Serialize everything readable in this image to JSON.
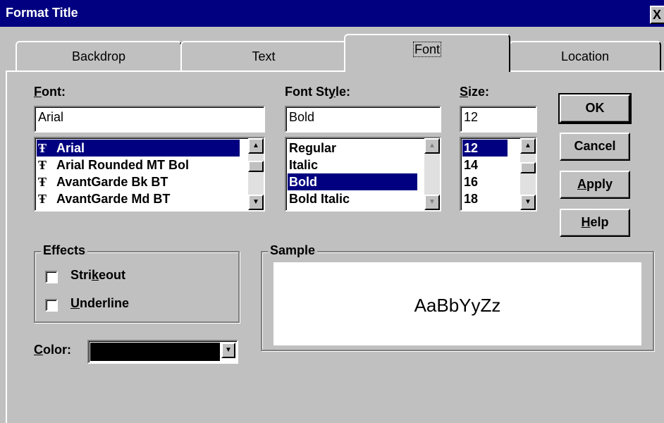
{
  "window": {
    "title": "Format Title",
    "close_glyph": "X"
  },
  "tabs": [
    {
      "label": "Backdrop",
      "active": false
    },
    {
      "label": "Text",
      "active": false
    },
    {
      "label": "Font",
      "active": true
    },
    {
      "label": "Location",
      "active": false
    }
  ],
  "font": {
    "label_prefix": "F",
    "label_rest": "ont:",
    "value": "Arial",
    "items": [
      "Arial",
      "Arial Rounded MT Bol",
      "AvantGarde Bk BT",
      "AvantGarde Md BT"
    ],
    "selected_index": 0,
    "item_icon": "truetype-icon"
  },
  "font_style": {
    "label_prefix": "Font St",
    "label_u": "y",
    "label_rest": "le:",
    "value": "Bold",
    "items": [
      "Regular",
      "Italic",
      "Bold",
      "Bold Italic"
    ],
    "selected_index": 2
  },
  "size": {
    "label_prefix": "S",
    "label_rest": "ize:",
    "value": "12",
    "items": [
      "12",
      "14",
      "16",
      "18"
    ],
    "selected_index": 0
  },
  "buttons": {
    "ok": "OK",
    "cancel": "Cancel",
    "apply_u": "A",
    "apply_rest": "pply",
    "help_u": "H",
    "help_rest": "elp"
  },
  "effects": {
    "legend": "Effects",
    "strikeout_pre": "Stri",
    "strikeout_u": "k",
    "strikeout_rest": "eout",
    "underline_u": "U",
    "underline_rest": "nderline",
    "strikeout_checked": false,
    "underline_checked": false
  },
  "color": {
    "label_u": "C",
    "label_rest": "olor:",
    "value_hex": "#000000"
  },
  "sample": {
    "legend": "Sample",
    "text": "AaBbYyZz"
  },
  "colors": {
    "title_bar": "#000080",
    "selection": "#000080",
    "face": "#c0c0c0"
  }
}
